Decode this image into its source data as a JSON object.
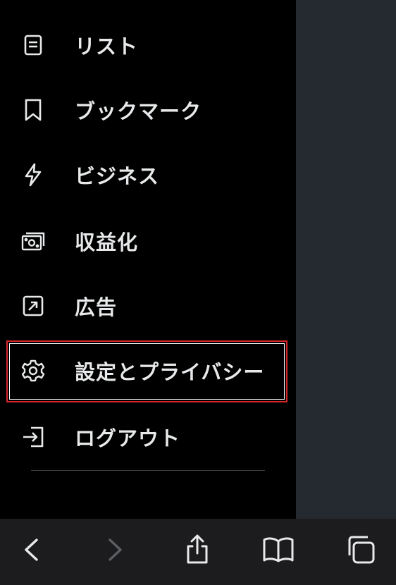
{
  "menu": {
    "items": [
      {
        "label": "リスト",
        "icon": "list-icon"
      },
      {
        "label": "ブックマーク",
        "icon": "bookmark-icon"
      },
      {
        "label": "ビジネス",
        "icon": "lightning-icon"
      },
      {
        "label": "収益化",
        "icon": "money-icon"
      },
      {
        "label": "広告",
        "icon": "ads-arrow-icon"
      },
      {
        "label": "設定とプライバシー",
        "icon": "gear-icon"
      },
      {
        "label": "ログアウト",
        "icon": "logout-icon"
      }
    ],
    "highlighted_item": "設定とプライバシー"
  },
  "browser_toolbar": {
    "buttons": [
      "back-icon",
      "forward-icon",
      "share-icon",
      "bookmarks-book-icon",
      "tabs-icon"
    ],
    "forward_enabled": false
  },
  "colors": {
    "background": "#000000",
    "backdrop": "#252a31",
    "text": "#e7e9ea",
    "highlight_border": "#d7262b",
    "toolbar": "#1c1c1e"
  }
}
